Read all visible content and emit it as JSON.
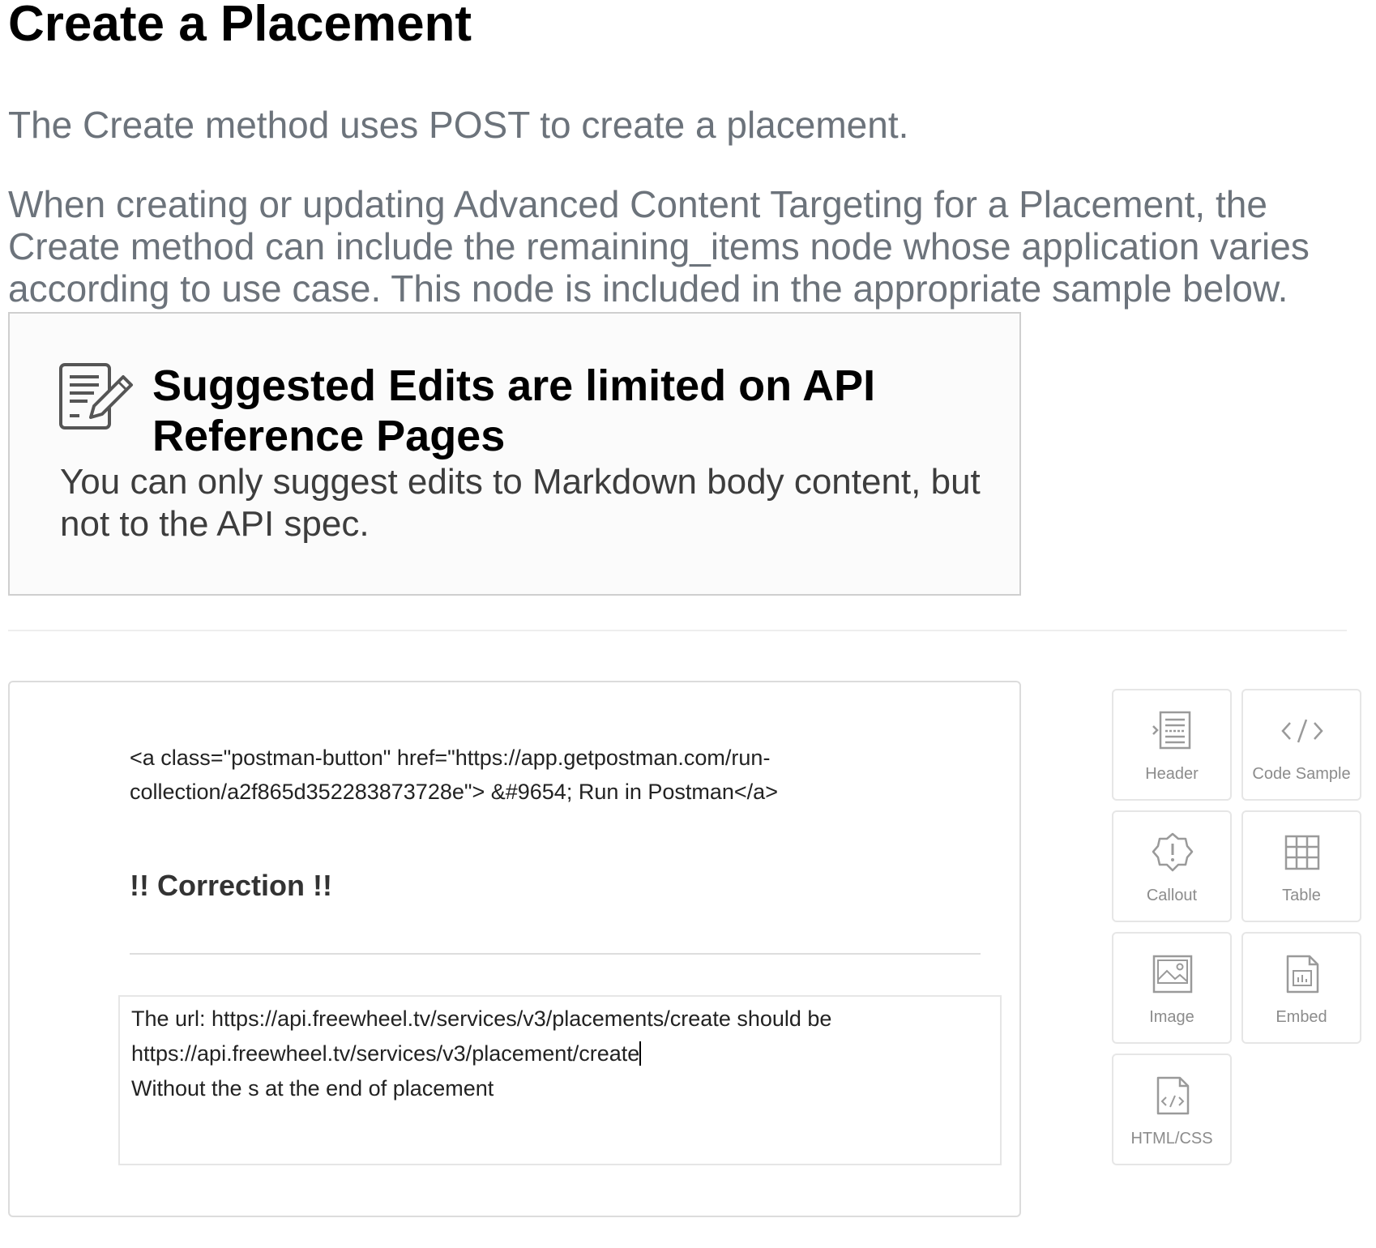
{
  "page": {
    "title": "Create a Placement",
    "intro": "The Create method uses POST to create a placement.",
    "intro2": "When creating or updating Advanced Content Targeting for a Placement, the Create method can include the remaining_items node whose application varies according to use case. This node is included in the appropriate sample below."
  },
  "notice": {
    "icon": "edit-document-icon",
    "title": "Suggested Edits are limited on API Reference Pages",
    "text": "You can only suggest edits to Markdown body content, but not to the API spec."
  },
  "editor": {
    "code_line": "<a class=\"postman-button\" href=\"https://app.getpostman.com/run-collection/a2f865d352283873728e\"> &#9654; Run in Postman</a>",
    "correction_heading": "!! Correction !!",
    "correction_lines": [
      "The url: https://api.freewheel.tv/services/v3/placements/create should be",
      "https://api.freewheel.tv/services/v3/placement/create",
      "Without the s at the end of placement"
    ]
  },
  "blocks": [
    {
      "label": "Header",
      "icon": "header-icon"
    },
    {
      "label": "Code Sample",
      "icon": "code-icon"
    },
    {
      "label": "Callout",
      "icon": "callout-icon"
    },
    {
      "label": "Table",
      "icon": "table-icon"
    },
    {
      "label": "Image",
      "icon": "image-icon"
    },
    {
      "label": "Embed",
      "icon": "embed-icon"
    },
    {
      "label": "HTML/CSS",
      "icon": "html-css-icon"
    }
  ]
}
